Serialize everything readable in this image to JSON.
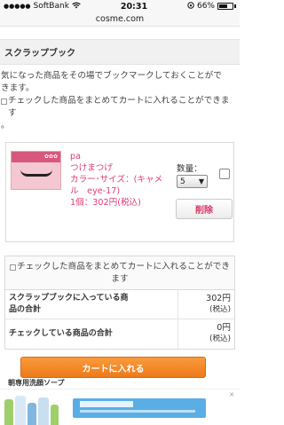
{
  "status_bar": {
    "carrier": "SoftBank",
    "time": "20:31",
    "battery_text": "66%",
    "battery_level": 0.66
  },
  "browser": {
    "url": "cosme.com"
  },
  "scrapbook": {
    "title": "スクラップブック",
    "intro_line1": "気になった商品をその場でブックマークしておくことがで",
    "intro_line2": "きます。",
    "instruction_line1": "チェックした商品をまとめてカートに入れることができます",
    "instruction_line2": "。"
  },
  "item": {
    "brand": "pa",
    "name": "つけまつげ",
    "variant_line1": "カラー･サイズ：(キャメ",
    "variant_line2": "ル　eye-17)",
    "price": "1個：302円(税込)",
    "qty_label": "数量：",
    "qty_value": "5",
    "delete_label": "削除"
  },
  "batch": {
    "line1": "チェックした商品をまとめてカートに入れることができ",
    "line2": "ます"
  },
  "summary": [
    {
      "label_line1": "スクラップブックに入っている商",
      "label_line2": "品の合計",
      "value": "302円",
      "tax": "(税込)"
    },
    {
      "label_line1": "チェックしている商品の合計",
      "label_line2": "",
      "value": "0円",
      "tax": "(税込)"
    }
  ],
  "cart_button": "カートに入れる",
  "footer": {
    "label": "朝専用洗顔ソープ"
  },
  "colors": {
    "accent_pink": "#e03a77",
    "cart_orange": "#f08a28",
    "banner_blue": "#5aaee6"
  }
}
